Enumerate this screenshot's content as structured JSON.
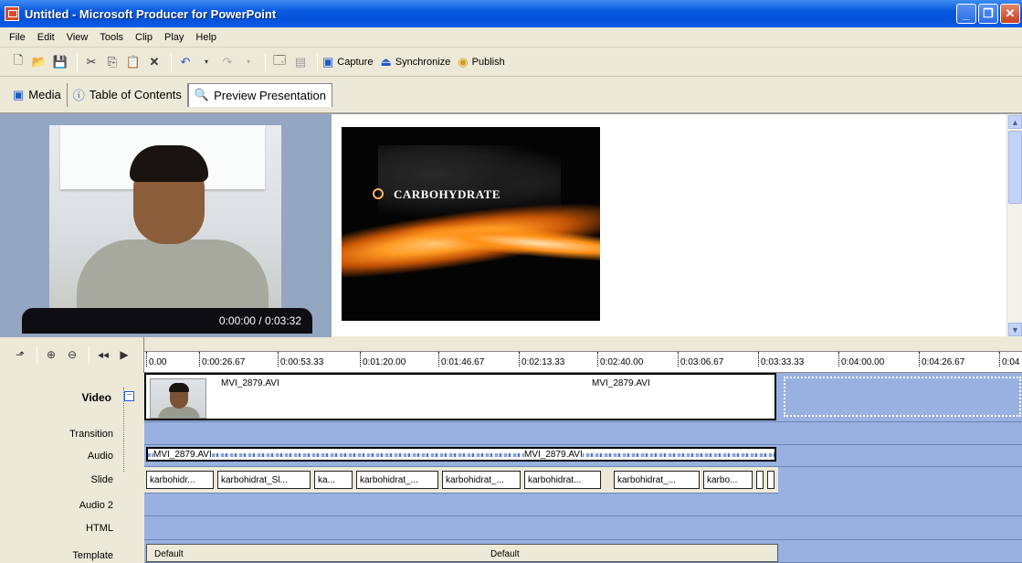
{
  "window": {
    "title": "Untitled - Microsoft Producer for PowerPoint"
  },
  "menu": [
    "File",
    "Edit",
    "View",
    "Tools",
    "Clip",
    "Play",
    "Help"
  ],
  "toolbar": {
    "capture": "Capture",
    "synchronize": "Synchronize",
    "publish": "Publish"
  },
  "tabs": [
    {
      "label": "Media"
    },
    {
      "label": "Table of Contents"
    },
    {
      "label": "Preview Presentation"
    }
  ],
  "preview": {
    "time": "0:00:00 / 0:03:32",
    "slide_title": "CARBOHYDRATE"
  },
  "ruler": [
    "0.00",
    "0:00:26.67",
    "0:00:53.33",
    "0:01:20.00",
    "0:01:46.67",
    "0:02:13.33",
    "0:02:40.00",
    "0:03:06.67",
    "0:03:33.33",
    "0:04:00.00",
    "0:04:26.67",
    "0:04"
  ],
  "tracks": {
    "video": "Video",
    "transition": "Transition",
    "audio": "Audio",
    "slide": "Slide",
    "audio2": "Audio 2",
    "html": "HTML",
    "template": "Template"
  },
  "video_clip": {
    "name1": "MVI_2879.AVI",
    "name2": "MVI_2879.AVI"
  },
  "audio_clip": {
    "name1": "MVI_2879.AVI",
    "name2": "MVI_2879.AVI"
  },
  "slides": [
    "karbohidr...",
    "karbohidrat_Sl...",
    "ka...",
    "karbohidrat_...",
    "karbohidrat_...",
    "karbohidrat...",
    "karbohidrat_...",
    "karbo..."
  ],
  "template": {
    "left": "Default",
    "center": "Default"
  },
  "colors": {
    "titlebar": "#0a5ae0",
    "timeline_track": "#99b1e0",
    "chrome": "#ece9d8"
  }
}
